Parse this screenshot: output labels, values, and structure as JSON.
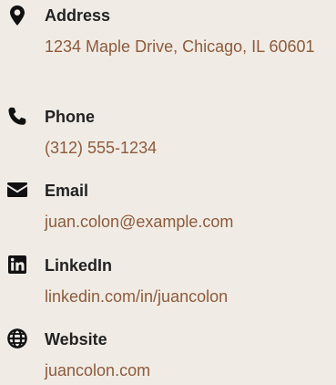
{
  "colors": {
    "background": "#f0ece5",
    "label": "#222222",
    "value": "#8e5a3c",
    "icon": "#111111"
  },
  "contacts": [
    {
      "icon": "map-marker-icon",
      "label": "Address",
      "value": "1234 Maple Drive, Chicago, IL 60601"
    },
    {
      "icon": "phone-icon",
      "label": "Phone",
      "value": "(312) 555-1234"
    },
    {
      "icon": "envelope-icon",
      "label": "Email",
      "value": "juan.colon@example.com"
    },
    {
      "icon": "linkedin-icon",
      "label": "LinkedIn",
      "value": "linkedin.com/in/juancolon"
    },
    {
      "icon": "globe-icon",
      "label": "Website",
      "value": "juancolon.com"
    }
  ]
}
